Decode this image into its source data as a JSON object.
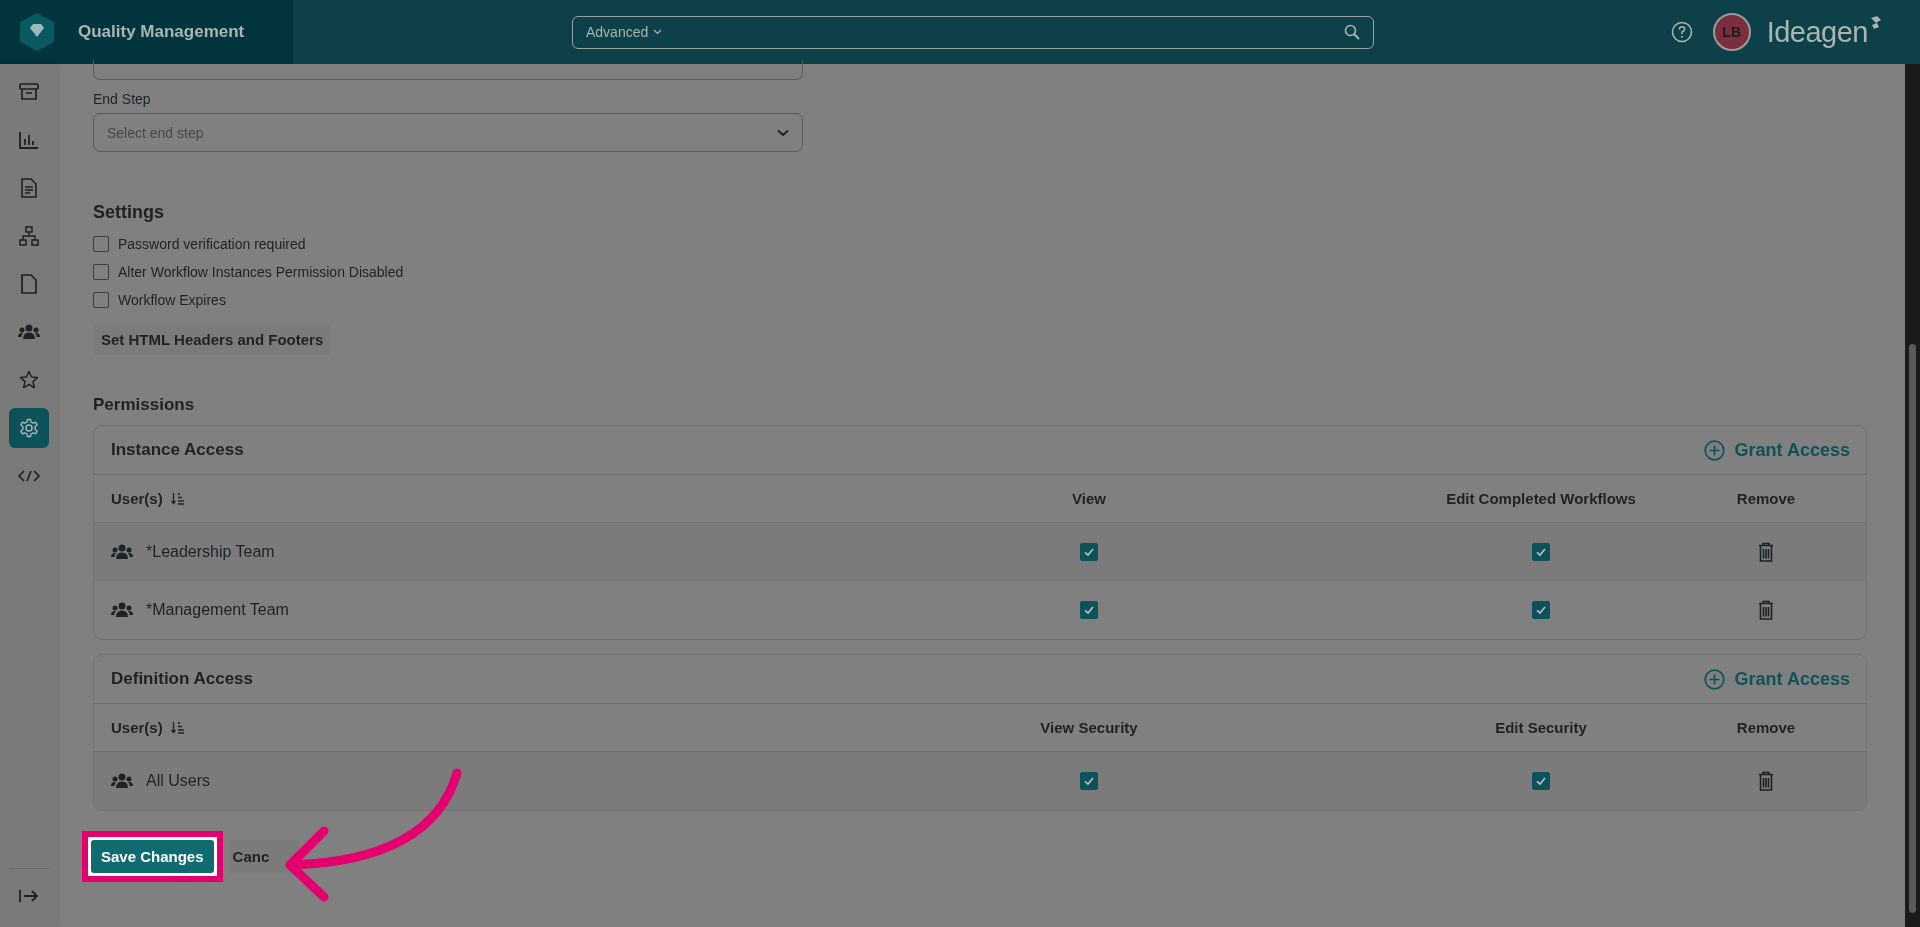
{
  "header": {
    "app_title": "Quality Management",
    "search": {
      "scope": "Advanced"
    },
    "avatar_initials": "LB",
    "brand": "Ideagen"
  },
  "sidebar": {
    "items": [
      {
        "kind": "archive",
        "selected": false
      },
      {
        "kind": "chart",
        "selected": false
      },
      {
        "kind": "document",
        "selected": false
      },
      {
        "kind": "hierarchy",
        "selected": false
      },
      {
        "kind": "file",
        "selected": false
      },
      {
        "kind": "group",
        "selected": false
      },
      {
        "kind": "star",
        "selected": false
      },
      {
        "kind": "settings",
        "selected": true
      },
      {
        "kind": "code",
        "selected": false
      }
    ]
  },
  "form": {
    "end_step": {
      "label": "End Step",
      "placeholder": "Select end step"
    },
    "settings": {
      "heading": "Settings",
      "options": [
        {
          "label": "Password verification required",
          "checked": false
        },
        {
          "label": "Alter Workflow Instances Permission Disabled",
          "checked": false
        },
        {
          "label": "Workflow Expires",
          "checked": false
        }
      ]
    },
    "html_button": "Set HTML Headers and Footers",
    "permissions": {
      "heading": "Permissions",
      "sections": [
        {
          "title": "Instance Access",
          "action": "Grant Access",
          "columns": [
            "User(s)",
            "View",
            "Edit Completed Workflows",
            "Remove"
          ],
          "rows": [
            {
              "name": "*Leadership Team",
              "values": [
                true,
                true
              ]
            },
            {
              "name": "*Management Team",
              "values": [
                true,
                true
              ]
            }
          ]
        },
        {
          "title": "Definition Access",
          "action": "Grant Access",
          "columns": [
            "User(s)",
            "View Security",
            "Edit Security",
            "Remove"
          ],
          "rows": [
            {
              "name": "All Users",
              "values": [
                true,
                true
              ]
            }
          ]
        }
      ]
    }
  },
  "footer": {
    "save": "Save Changes",
    "cancel": "Canc"
  }
}
